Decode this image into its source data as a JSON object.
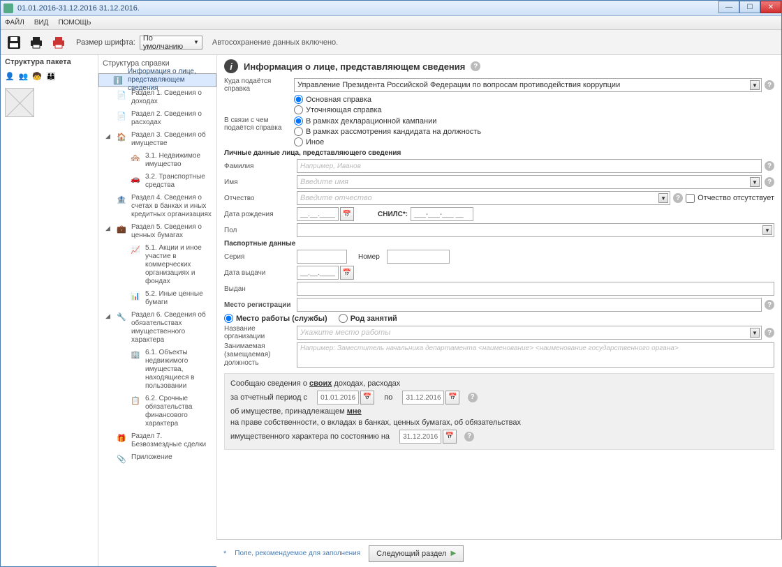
{
  "title": "01.01.2016-31.12.2016 31.12.2016.",
  "menu": {
    "file": "ФАЙЛ",
    "view": "ВИД",
    "help": "ПОМОЩЬ"
  },
  "toolbar": {
    "font_label": "Размер шрифта:",
    "font_value": "По умолчанию",
    "autosave": "Автосохранение данных включено."
  },
  "left": {
    "header": "Структура пакета"
  },
  "mid": {
    "header": "Структура справки",
    "items": [
      {
        "label": "Информация о лице, представляющем сведения",
        "sel": true
      },
      {
        "label": "Раздел 1. Сведения о доходах"
      },
      {
        "label": "Раздел 2. Сведения о расходах"
      },
      {
        "label": "Раздел 3. Сведения об имуществе",
        "exp": true
      },
      {
        "label": "3.1. Недвижимое имущество",
        "sub": true
      },
      {
        "label": "3.2. Транспортные средства",
        "sub": true
      },
      {
        "label": "Раздел 4. Сведения о счетах в банках и иных кредитных организациях"
      },
      {
        "label": "Раздел 5. Сведения о ценных бумагах",
        "exp": true
      },
      {
        "label": "5.1. Акции и иное участие в коммерческих организациях и фондах",
        "sub": true
      },
      {
        "label": "5.2. Иные ценные бумаги",
        "sub": true
      },
      {
        "label": "Раздел 6. Сведения об обязательствах имущественного характера",
        "exp": true
      },
      {
        "label": "6.1. Объекты недвижимого имущества, находящиеся в пользовании",
        "sub": true
      },
      {
        "label": "6.2. Срочные обязательства финансового характера",
        "sub": true
      },
      {
        "label": "Раздел 7. Безвозмездные сделки"
      },
      {
        "label": "Приложение"
      }
    ]
  },
  "main": {
    "title": "Информация о лице, представляющем сведения",
    "where_label": "Куда подаётся справка",
    "where_value": "Управление Президента Российской Федерации по вопросам противодействия коррупции",
    "type_radios": {
      "main": "Основная справка",
      "upd": "Уточняющая справка"
    },
    "reason_label": "В связи с чем подаётся справка",
    "reason_radios": {
      "decl": "В рамках декларационной кампании",
      "cand": "В рамках рассмотрения кандидата на должность",
      "other": "Иное"
    },
    "personal_header": "Личные данные лица, представляющего сведения",
    "surname": {
      "label": "Фамилия",
      "ph": "Например, Иванов"
    },
    "name": {
      "label": "Имя",
      "ph": "Введите имя"
    },
    "patr": {
      "label": "Отчество",
      "ph": "Введите отчество",
      "cb": "Отчество отсутствует"
    },
    "dob": {
      "label": "Дата рождения",
      "ph": "__.__.____"
    },
    "snils": {
      "label": "СНИЛС*:",
      "ph": "___-___-___ __"
    },
    "gender": {
      "label": "Пол"
    },
    "passport_header": "Паспортные данные",
    "series": {
      "label": "Серия"
    },
    "number": {
      "label": "Номер"
    },
    "issue_date": {
      "label": "Дата выдачи",
      "ph": "__.__.____"
    },
    "issued_by": {
      "label": "Выдан"
    },
    "reg_header": "Место регистрации",
    "work_radio": "Место работы (службы)",
    "occ_radio": "Род занятий",
    "org": {
      "label": "Название организации",
      "ph": "Укажите место работы"
    },
    "pos": {
      "label": "Занимаемая (замещаемая) должность",
      "ph": "Например: Заместитель начальника департамента <наименование> <наименование государственного органа>"
    },
    "report": {
      "l1": "Сообщаю сведения о ",
      "u1": "своих",
      "l1b": " доходах, расходах",
      "l2": "за отчетный период с",
      "d1": "01.01.2016",
      "to": "по",
      "d2": "31.12.2016",
      "l3a": "об имуществе, принадлежащем ",
      "u2": "мне",
      "l3b": "на праве собственности, о вкладах в банках, ценных бумагах, об обязательствах",
      "l4": "имущественного характера по состоянию на",
      "d3": "31.12.2016"
    },
    "reqnote": "Поле, рекомендуемое для заполнения",
    "next": "Следующий раздел"
  }
}
